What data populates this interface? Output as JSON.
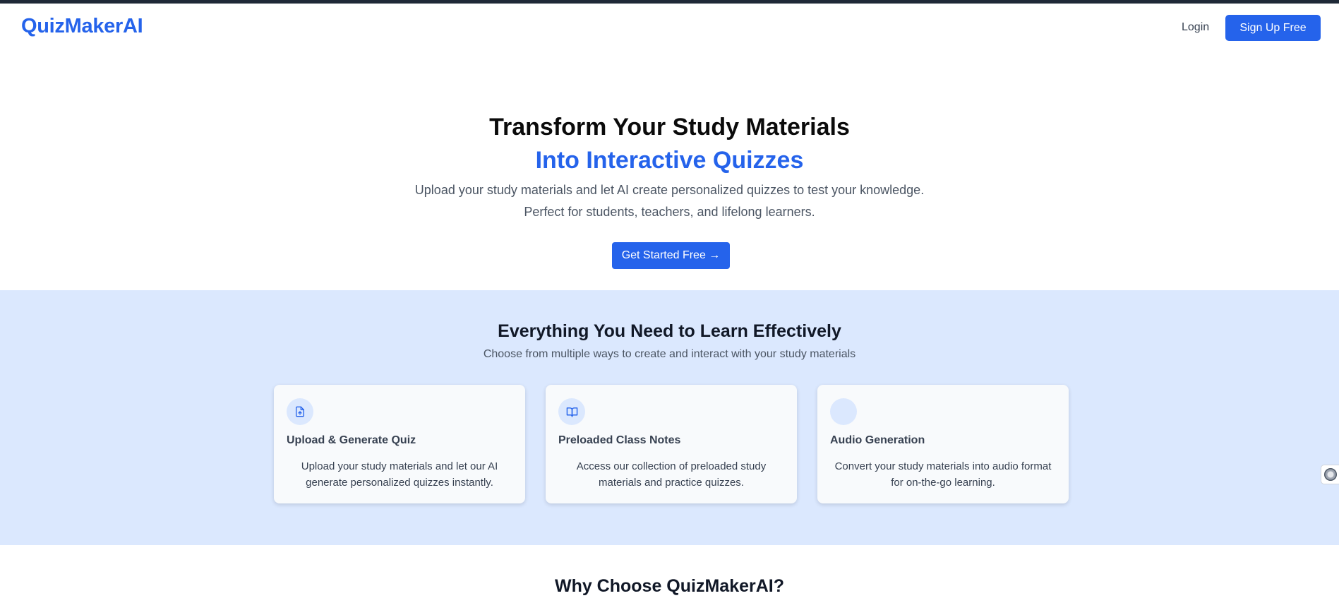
{
  "brand": {
    "name": "QuizMakerAI",
    "color": "#2563eb"
  },
  "nav": {
    "login_label": "Login",
    "signup_label": "Sign Up Free"
  },
  "hero": {
    "title_line1": "Transform Your Study Materials",
    "title_line2": "Into Interactive Quizzes",
    "subtitle_line1": "Upload your study materials and let AI create personalized quizzes to test your knowledge.",
    "subtitle_line2": "Perfect for students, teachers, and lifelong learners.",
    "cta_label": "Get Started Free →"
  },
  "features": {
    "title": "Everything You Need to Learn Effectively",
    "subtitle": "Choose from multiple ways to create and interact with your study materials",
    "background": "#dbe8fe",
    "cards": [
      {
        "icon": "file-upload-icon",
        "title": "Upload & Generate Quiz",
        "description": "Upload your study materials and let our AI generate personalized quizzes instantly."
      },
      {
        "icon": "book-open-icon",
        "title": "Preloaded Class Notes",
        "description": "Access our collection of preloaded study materials and practice quizzes."
      },
      {
        "icon": "audio-icon",
        "title": "Audio Generation",
        "description": "Convert your study materials into audio format for on-the-go learning."
      }
    ]
  },
  "why": {
    "title": "Why Choose QuizMakerAI?"
  }
}
